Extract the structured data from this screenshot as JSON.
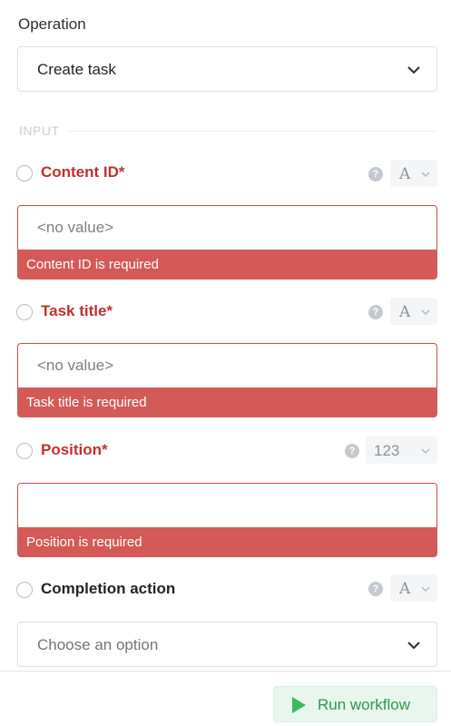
{
  "operation": {
    "label": "Operation",
    "selected": "Create task"
  },
  "section": {
    "label": "INPUT"
  },
  "fields": [
    {
      "label": "Content ID*",
      "type_indicator": "A",
      "placeholder": "<no value>",
      "error": "Content ID is required",
      "required": true
    },
    {
      "label": "Task title*",
      "type_indicator": "A",
      "placeholder": "<no value>",
      "error": "Task title is required",
      "required": true
    },
    {
      "label": "Position*",
      "type_indicator": "123",
      "placeholder": "",
      "error": "Position is required",
      "required": true
    },
    {
      "label": "Completion action",
      "type_indicator": "A",
      "placeholder": "Choose an option",
      "required": false
    }
  ],
  "footer": {
    "run_label": "Run workflow"
  },
  "colors": {
    "error": "#c0312d",
    "error_bar": "#d45a57",
    "run_green": "#3cb95e"
  },
  "icons": {
    "help": "question-circle-icon",
    "chevron": "chevron-down-icon",
    "play": "play-icon"
  }
}
